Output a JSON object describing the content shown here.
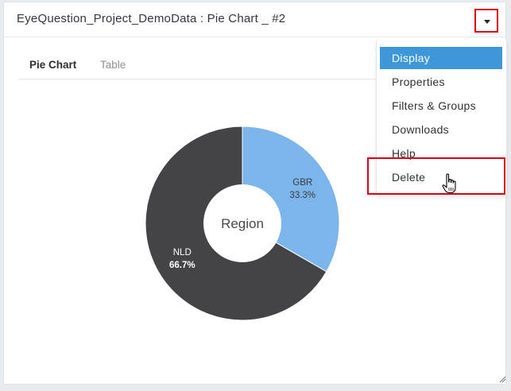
{
  "panel": {
    "title": "EyeQuestion_Project_DemoData : Pie Chart _ #2"
  },
  "tabs": [
    {
      "label": "Pie Chart",
      "active": true
    },
    {
      "label": "Table",
      "active": false
    }
  ],
  "menu": {
    "items": [
      {
        "label": "Display",
        "active": true
      },
      {
        "label": "Properties",
        "active": false
      },
      {
        "label": "Filters & Groups",
        "active": false
      },
      {
        "label": "Downloads",
        "active": false
      },
      {
        "label": "Help",
        "active": false
      },
      {
        "label": "Delete",
        "active": false
      }
    ],
    "toggle_icon": "caret-down-icon"
  },
  "chart_data": {
    "type": "pie",
    "center_label": "Region",
    "slices": [
      {
        "label": "GBR",
        "value": 33.3,
        "percent_label": "33.3%",
        "color": "#7cb5ec"
      },
      {
        "label": "NLD",
        "value": 66.7,
        "percent_label": "66.7%",
        "color": "#434348"
      }
    ]
  },
  "colors": {
    "accent": "#3d97d9",
    "highlight": "#e0000f"
  }
}
